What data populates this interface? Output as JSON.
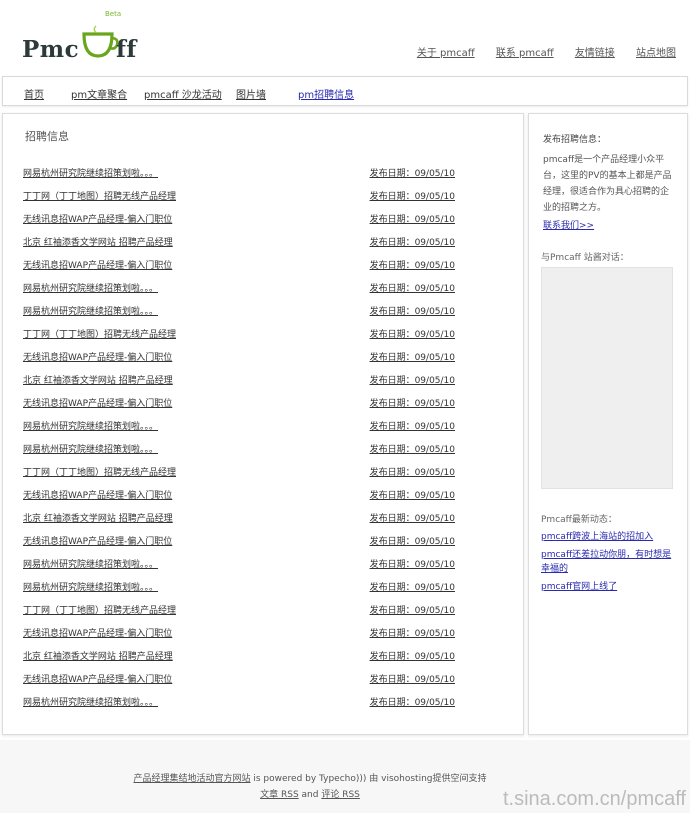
{
  "header": {
    "logo_text": "Pmc",
    "logo_text_suffix": "ff",
    "logo_badge": "Beta",
    "top_links": [
      "关于 pmcaff",
      "联系 pmcaff",
      "友情链接",
      "站点地图"
    ]
  },
  "nav": {
    "items": [
      "首页",
      "pm文章聚合",
      "pmcaff 沙龙活动",
      "图片墙",
      "pm招聘信息"
    ],
    "active_index": 4
  },
  "main": {
    "title": "招聘信息",
    "jobs": [
      {
        "title": "网易杭州研究院继续招策划啦。。。",
        "date": "发布日期：09/05/10"
      },
      {
        "title": "丁丁网（丁丁地图）招聘无线产品经理",
        "date": "发布日期：09/05/10"
      },
      {
        "title": "无线讯息招WAP产品经理-偏入门职位",
        "date": "发布日期：09/05/10"
      },
      {
        "title": "北京 红袖添香文学网站 招聘产品经理",
        "date": "发布日期：09/05/10"
      },
      {
        "title": "无线讯息招WAP产品经理-偏入门职位",
        "date": "发布日期：09/05/10"
      },
      {
        "title": "网易杭州研究院继续招策划啦。。。",
        "date": "发布日期：09/05/10"
      },
      {
        "title": "网易杭州研究院继续招策划啦。。。",
        "date": "发布日期：09/05/10"
      },
      {
        "title": "丁丁网（丁丁地图）招聘无线产品经理",
        "date": "发布日期：09/05/10"
      },
      {
        "title": "无线讯息招WAP产品经理-偏入门职位",
        "date": "发布日期：09/05/10"
      },
      {
        "title": "北京 红袖添香文学网站 招聘产品经理",
        "date": "发布日期：09/05/10"
      },
      {
        "title": "无线讯息招WAP产品经理-偏入门职位",
        "date": "发布日期：09/05/10"
      },
      {
        "title": "网易杭州研究院继续招策划啦。。。",
        "date": "发布日期：09/05/10"
      },
      {
        "title": "网易杭州研究院继续招策划啦。。。",
        "date": "发布日期：09/05/10"
      },
      {
        "title": "丁丁网（丁丁地图）招聘无线产品经理",
        "date": "发布日期：09/05/10"
      },
      {
        "title": "无线讯息招WAP产品经理-偏入门职位",
        "date": "发布日期：09/05/10"
      },
      {
        "title": "北京 红袖添香文学网站 招聘产品经理",
        "date": "发布日期：09/05/10"
      },
      {
        "title": "无线讯息招WAP产品经理-偏入门职位",
        "date": "发布日期：09/05/10"
      },
      {
        "title": "网易杭州研究院继续招策划啦。。。",
        "date": "发布日期：09/05/10"
      },
      {
        "title": "网易杭州研究院继续招策划啦。。。",
        "date": "发布日期：09/05/10"
      },
      {
        "title": "丁丁网（丁丁地图）招聘无线产品经理",
        "date": "发布日期：09/05/10"
      },
      {
        "title": "无线讯息招WAP产品经理-偏入门职位",
        "date": "发布日期：09/05/10"
      },
      {
        "title": "北京 红袖添香文学网站 招聘产品经理",
        "date": "发布日期：09/05/10"
      },
      {
        "title": "无线讯息招WAP产品经理-偏入门职位",
        "date": "发布日期：09/05/10"
      },
      {
        "title": "网易杭州研究院继续招策划啦。。。",
        "date": "发布日期：09/05/10"
      }
    ]
  },
  "sidebar": {
    "post_heading": "发布招聘信息：",
    "post_desc": "pmcaff是一个产品经理小众平台，这里的PV的基本上都是产品经理，很适合作为具心招聘的企业的招聘之方。",
    "post_link": "联系我们>>",
    "chat_heading": "与Pmcaff 站酱对话：",
    "news_heading": "Pmcaff最新动态：",
    "news": [
      "pmcaff跨波上海站的招加入",
      "pmcaff还差拉动你朋，有时想是幸福的",
      "pmcaff官网上线了"
    ]
  },
  "footer": {
    "line1_link": "产品经理集结地活动官方网站",
    "line1_text": " is powered by Typecho))) 由 visohosting提供空间支持",
    "line2_link1": "文章 RSS",
    "line2_mid": " and ",
    "line2_link2": "评论 RSS",
    "watermark": "t.sina.com.cn/pmcaff"
  }
}
